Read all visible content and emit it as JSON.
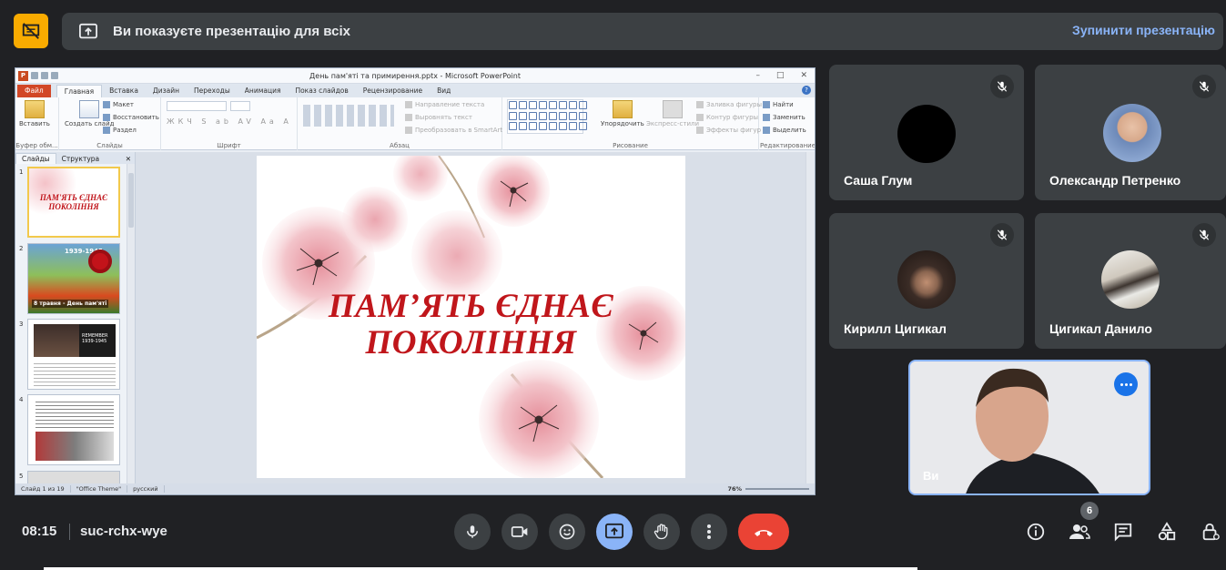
{
  "banner": {
    "message": "Ви показуєте презентацію для всіх",
    "stop_label": "Зупинити презентацію"
  },
  "ppt": {
    "window_title": "День пам'яті та примирення.pptx - Microsoft PowerPoint",
    "file_tab": "Файл",
    "tabs": [
      "Главная",
      "Вставка",
      "Дизайн",
      "Переходы",
      "Анимация",
      "Показ слайдов",
      "Рецензирование",
      "Вид"
    ],
    "ribbon": {
      "paste": "Вставить",
      "new_slide": "Создать слайд",
      "layout": "Макет",
      "reset": "Восстановить",
      "section": "Раздел",
      "text_direction": "Направление текста",
      "align_text": "Выровнять текст",
      "smartart": "Преобразовать в SmartArt",
      "arrange": "Упорядочить",
      "quick_styles": "Экспресс-стили",
      "shape_fill": "Заливка фигуры",
      "shape_outline": "Контур фигуры",
      "shape_effects": "Эффекты фигур",
      "find": "Найти",
      "replace": "Заменить",
      "select": "Выделить",
      "groups": {
        "clipboard": "Буфер обм...",
        "slides": "Слайды",
        "font": "Шрифт",
        "paragraph": "Абзац",
        "drawing": "Рисование",
        "editing": "Редактирование"
      }
    },
    "panel_tabs": [
      "Слайды",
      "Структура"
    ],
    "slide_numbers": [
      "1",
      "2",
      "3",
      "4",
      "5"
    ],
    "thumb1_text": [
      "ПАМ'ЯТЬ ЄДНАЄ",
      "ПОКОЛІННЯ"
    ],
    "thumb2_date": "1939-1945",
    "thumb2_caption": "8 травня - День пам'яті",
    "thumb3_caption": "REMEMBER 1939-1945",
    "slide_title_line1": "ПАМ’ЯТЬ ЄДНАЄ",
    "slide_title_line2": "ПОКОЛІННЯ",
    "status": {
      "slide": "Слайд 1 из 19",
      "theme": "\"Office Theme\"",
      "lang": "русский",
      "zoom": "76%"
    }
  },
  "participants": [
    {
      "name": "Саша Глум"
    },
    {
      "name": "Олександр Петренко"
    },
    {
      "name": "Кирилл Цигикал"
    },
    {
      "name": "Цигикал Данило"
    }
  ],
  "self": {
    "name": "Ви"
  },
  "meeting": {
    "time": "08:15",
    "code": "suc-rchx-wye",
    "participant_count": "6"
  },
  "colors": {
    "present_accent": "#8ab4f8",
    "hangup": "#ea4335",
    "presentation_badge": "#f9ab00",
    "slide_title": "#c0161b"
  }
}
